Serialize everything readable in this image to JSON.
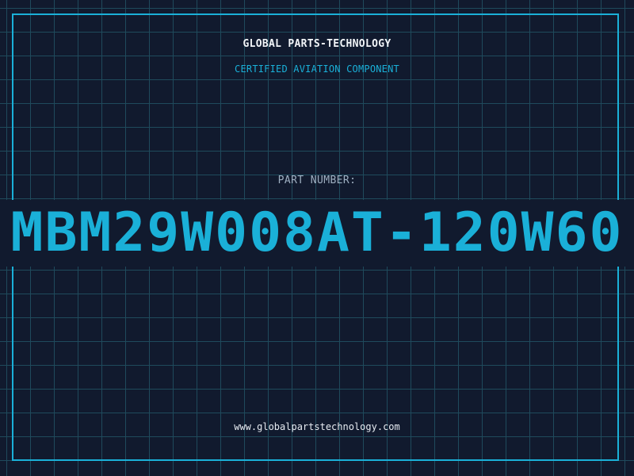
{
  "header": {
    "company": "GLOBAL PARTS-TECHNOLOGY",
    "tagline": "CERTIFIED AVIATION COMPONENT"
  },
  "part": {
    "label": "PART NUMBER:",
    "number": "MBM29W008AT-120W60"
  },
  "footer": {
    "website": "www.globalpartstechnology.com"
  },
  "colors": {
    "background": "#111a2e",
    "grid": "#1f4a5c",
    "accent": "#1ab0d8",
    "text": "#f2f5f8"
  }
}
